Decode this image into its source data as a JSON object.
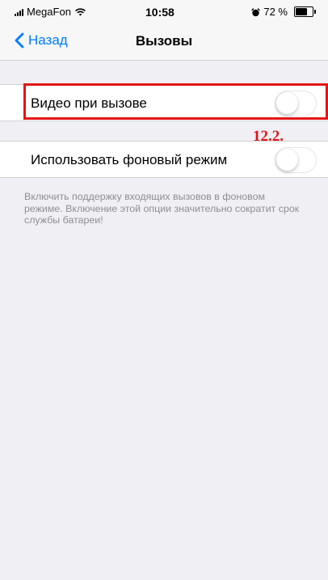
{
  "status_bar": {
    "carrier": "MegaFon",
    "time": "10:58",
    "battery_percent": "72 %",
    "battery_level": 0.72,
    "icons": [
      "signal-icon",
      "wifi-icon",
      "alarm-icon",
      "battery-icon"
    ]
  },
  "nav": {
    "back_label": "Назад",
    "title": "Вызовы",
    "accent_color": "#007aff"
  },
  "settings": {
    "video_on_call": {
      "label": "Видео при вызове",
      "enabled": false
    },
    "background_mode": {
      "label": "Использовать фоновый режим",
      "enabled": false,
      "footer": "Включить поддержку входящих вызовов в фоновом режиме. Включение этой опции значительно сократит срок службы батареи!"
    }
  },
  "annotation": {
    "label": "12.2.",
    "color": "#e31515"
  }
}
